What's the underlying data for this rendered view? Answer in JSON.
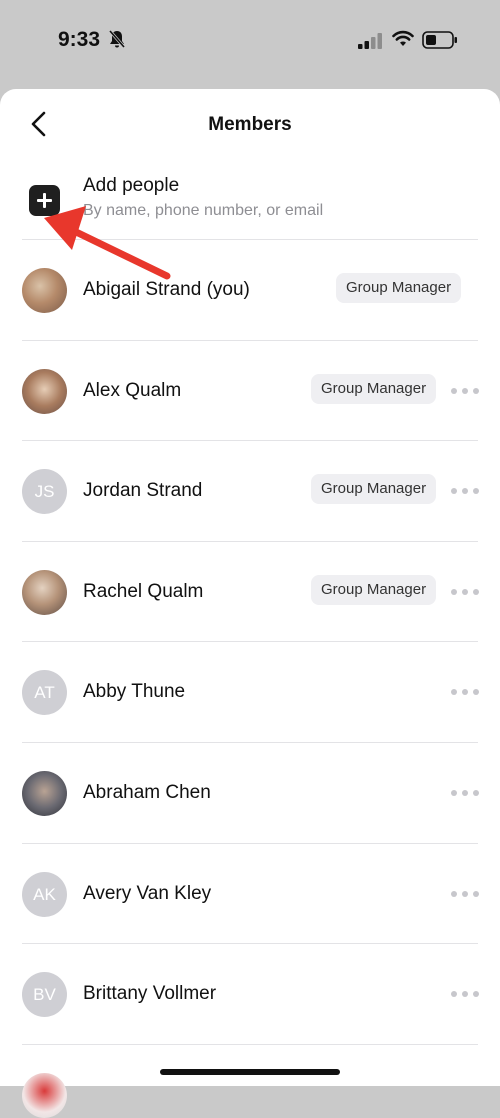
{
  "status_bar": {
    "time": "9:33"
  },
  "header": {
    "title": "Members"
  },
  "add_people": {
    "title": "Add people",
    "subtitle": "By name, phone number, or email"
  },
  "members": [
    {
      "name": "Abigail Strand (you)",
      "badge": "Group Manager",
      "initials": "",
      "has_more_menu": false
    },
    {
      "name": "Alex Qualm",
      "badge": "Group Manager",
      "initials": "",
      "has_more_menu": true
    },
    {
      "name": "Jordan Strand",
      "badge": "Group Manager",
      "initials": "JS",
      "has_more_menu": true
    },
    {
      "name": "Rachel Qualm",
      "badge": "Group Manager",
      "initials": "",
      "has_more_menu": true
    },
    {
      "name": "Abby Thune",
      "badge": "",
      "initials": "AT",
      "has_more_menu": true
    },
    {
      "name": "Abraham Chen",
      "badge": "",
      "initials": "",
      "has_more_menu": true
    },
    {
      "name": "Avery Van Kley",
      "badge": "",
      "initials": "AK",
      "has_more_menu": true
    },
    {
      "name": "Brittany Vollmer",
      "badge": "",
      "initials": "BV",
      "has_more_menu": true
    }
  ],
  "colors": {
    "accent_arrow": "#e8372c",
    "badge_bg": "#efeff2",
    "initials_avatar_bg": "#cfcfd4"
  }
}
